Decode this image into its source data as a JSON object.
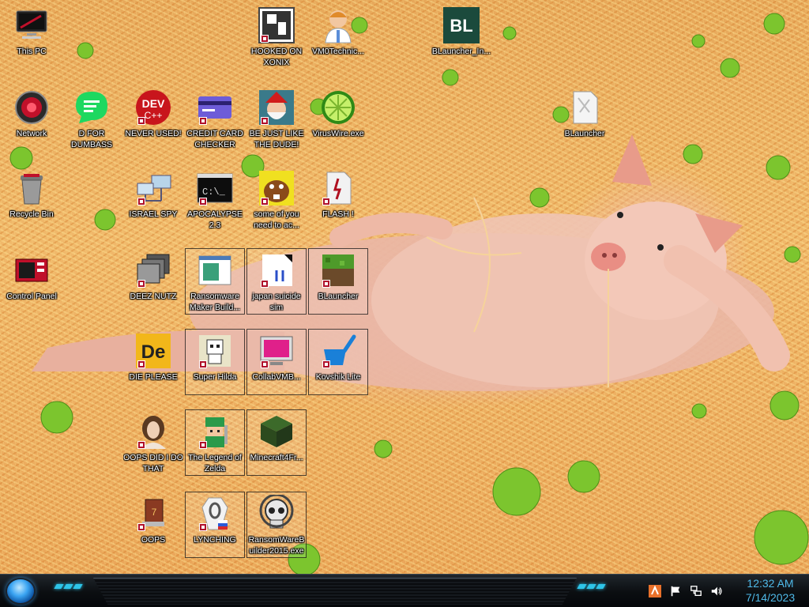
{
  "desktop": {
    "icons": [
      {
        "id": "this-pc",
        "label": "This PC",
        "icon": "computer-icon"
      },
      {
        "id": "hooked-on-xonix",
        "label": "HOOKED ON XONIX",
        "icon": "xonix-icon"
      },
      {
        "id": "vmtechnic",
        "label": "VM0Technic...",
        "icon": "doctor-icon"
      },
      {
        "id": "blauncher-in",
        "label": "BLauncher_In...",
        "icon": "bl-logo-icon"
      },
      {
        "id": "network",
        "label": "Network",
        "icon": "network-icon"
      },
      {
        "id": "d-for-dumbass",
        "label": "D FOR DUMBASS",
        "icon": "chat-icon"
      },
      {
        "id": "never-used",
        "label": "NEVER USED!",
        "icon": "devcpp-icon"
      },
      {
        "id": "credit-card-checker",
        "label": "CREDIT CARD CHECKER",
        "icon": "credit-card-icon"
      },
      {
        "id": "be-just-like-the-dude",
        "label": "BE JUST LIKE THE DUDE!",
        "icon": "santa-icon"
      },
      {
        "id": "viruswire",
        "label": "VirusWire.exe",
        "icon": "lime-icon"
      },
      {
        "id": "blauncher-top",
        "label": "BLauncher",
        "icon": "document-icon"
      },
      {
        "id": "recycle-bin",
        "label": "Recycle Bin",
        "icon": "recycle-bin-icon"
      },
      {
        "id": "israel-spy",
        "label": "ISRAEL SPY",
        "icon": "network-computers-icon"
      },
      {
        "id": "apocalypse",
        "label": "APOCALYPSE 2.3",
        "icon": "terminal-icon"
      },
      {
        "id": "some-of-you",
        "label": "some of you need to ac...",
        "icon": "beaver-icon"
      },
      {
        "id": "flash",
        "label": "FLASH !",
        "icon": "flash-icon"
      },
      {
        "id": "control-panel",
        "label": "Control Panel",
        "icon": "control-panel-icon"
      },
      {
        "id": "deez-nutz",
        "label": "DEEZ NUTZ",
        "icon": "windows-stack-icon"
      },
      {
        "id": "ransomware-maker",
        "label": "Ransomware Maker Build...",
        "icon": "installer-icon"
      },
      {
        "id": "japan-suicide-sim",
        "label": "japan suicide sim",
        "icon": "page-icon"
      },
      {
        "id": "blauncher-mc",
        "label": "BLauncher",
        "icon": "grass-block-icon"
      },
      {
        "id": "die-please",
        "label": "DIE PLEASE",
        "icon": "de-icon"
      },
      {
        "id": "super-hilda",
        "label": "Super Hilda",
        "icon": "pixel-dog-icon"
      },
      {
        "id": "collabvm",
        "label": "CollabVMB...",
        "icon": "monitor-icon"
      },
      {
        "id": "kovshik-lite",
        "label": "Kovshik Lite",
        "icon": "ladle-icon"
      },
      {
        "id": "oops-did-i",
        "label": "OOPS DID I DO THAT",
        "icon": "portrait-icon"
      },
      {
        "id": "legend-of-zelda",
        "label": "The Legend of Zelda",
        "icon": "zelda-icon"
      },
      {
        "id": "minecraft4fr",
        "label": "Minecraft4Fr...",
        "icon": "dirt-block-icon"
      },
      {
        "id": "oops",
        "label": "OOPS",
        "icon": "book-icon"
      },
      {
        "id": "lynching",
        "label": "LYNCHING",
        "icon": "noose-icon"
      },
      {
        "id": "ransomwarebuilder",
        "label": "RansomWareBuilder2015.exe",
        "icon": "skull-icon"
      }
    ]
  },
  "taskbar": {
    "start_icon": "start-orb-icon",
    "tray_icons": [
      "app-tray-icon",
      "flag-icon",
      "network-tray-icon",
      "volume-icon"
    ],
    "time": "12:32 AM",
    "date": "7/14/2023"
  },
  "colors": {
    "clock": "#4fb9e8",
    "accent": "#2ec4e8"
  }
}
